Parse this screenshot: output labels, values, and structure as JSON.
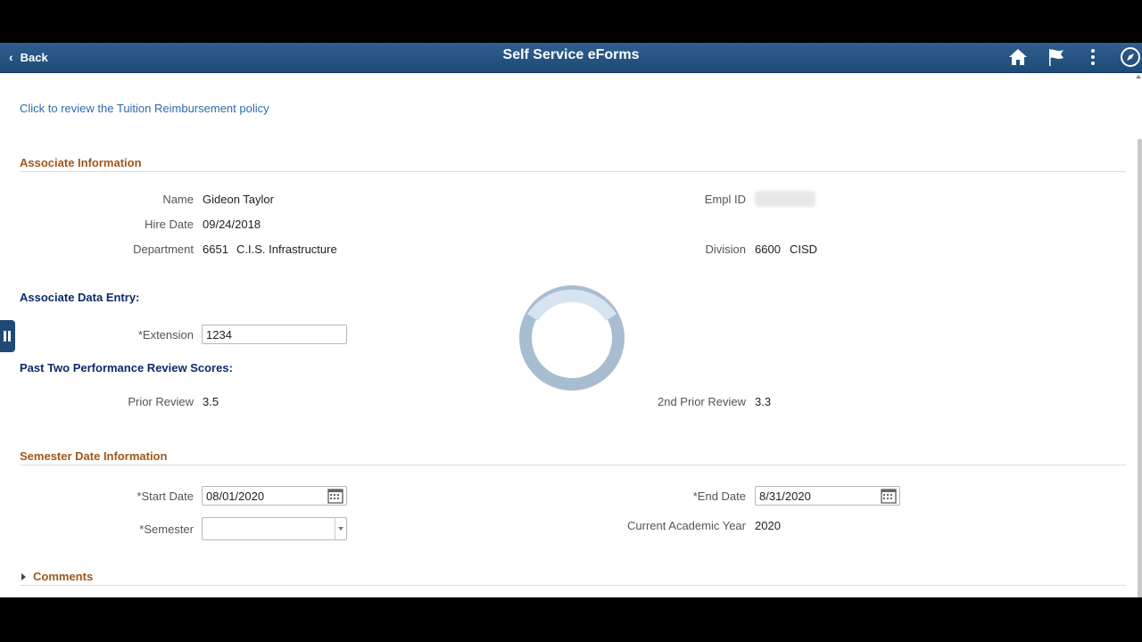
{
  "header": {
    "back_label": "Back",
    "title": "Self Service eForms",
    "icons": [
      "home-icon",
      "flag-icon",
      "more-vertical-icon",
      "compass-icon"
    ],
    "color": "#1e4a76"
  },
  "policy_link": "Click to review the Tuition Reimbursement policy",
  "associate_info": {
    "heading": "Associate Information",
    "name_label": "Name",
    "name_value": "Gideon Taylor",
    "empl_id_label": "Empl ID",
    "hire_date_label": "Hire Date",
    "hire_date_value": "09/24/2018",
    "department_label": "Department",
    "department_code": "6651",
    "department_name": "C.I.S. Infrastructure",
    "division_label": "Division",
    "division_code": "6600",
    "division_name": "CISD"
  },
  "data_entry": {
    "heading": "Associate Data Entry:",
    "extension_label": "*Extension",
    "extension_value": "1234"
  },
  "reviews": {
    "heading": "Past Two Performance Review Scores:",
    "prior_label": "Prior Review",
    "prior_value": "3.5",
    "second_label": "2nd Prior Review",
    "second_value": "3.3"
  },
  "semester": {
    "heading": "Semester Date Information",
    "start_label": "*Start Date",
    "start_value": "08/01/2020",
    "end_label": "*End Date",
    "end_value": "8/31/2020",
    "semester_label": "*Semester",
    "semester_value": "",
    "academic_year_label": "Current Academic Year",
    "academic_year_value": "2020"
  },
  "comments_label": "Comments",
  "colors": {
    "section_heading": "#a0561a",
    "group_heading": "#0e2a6b",
    "link": "#2d6aad"
  }
}
